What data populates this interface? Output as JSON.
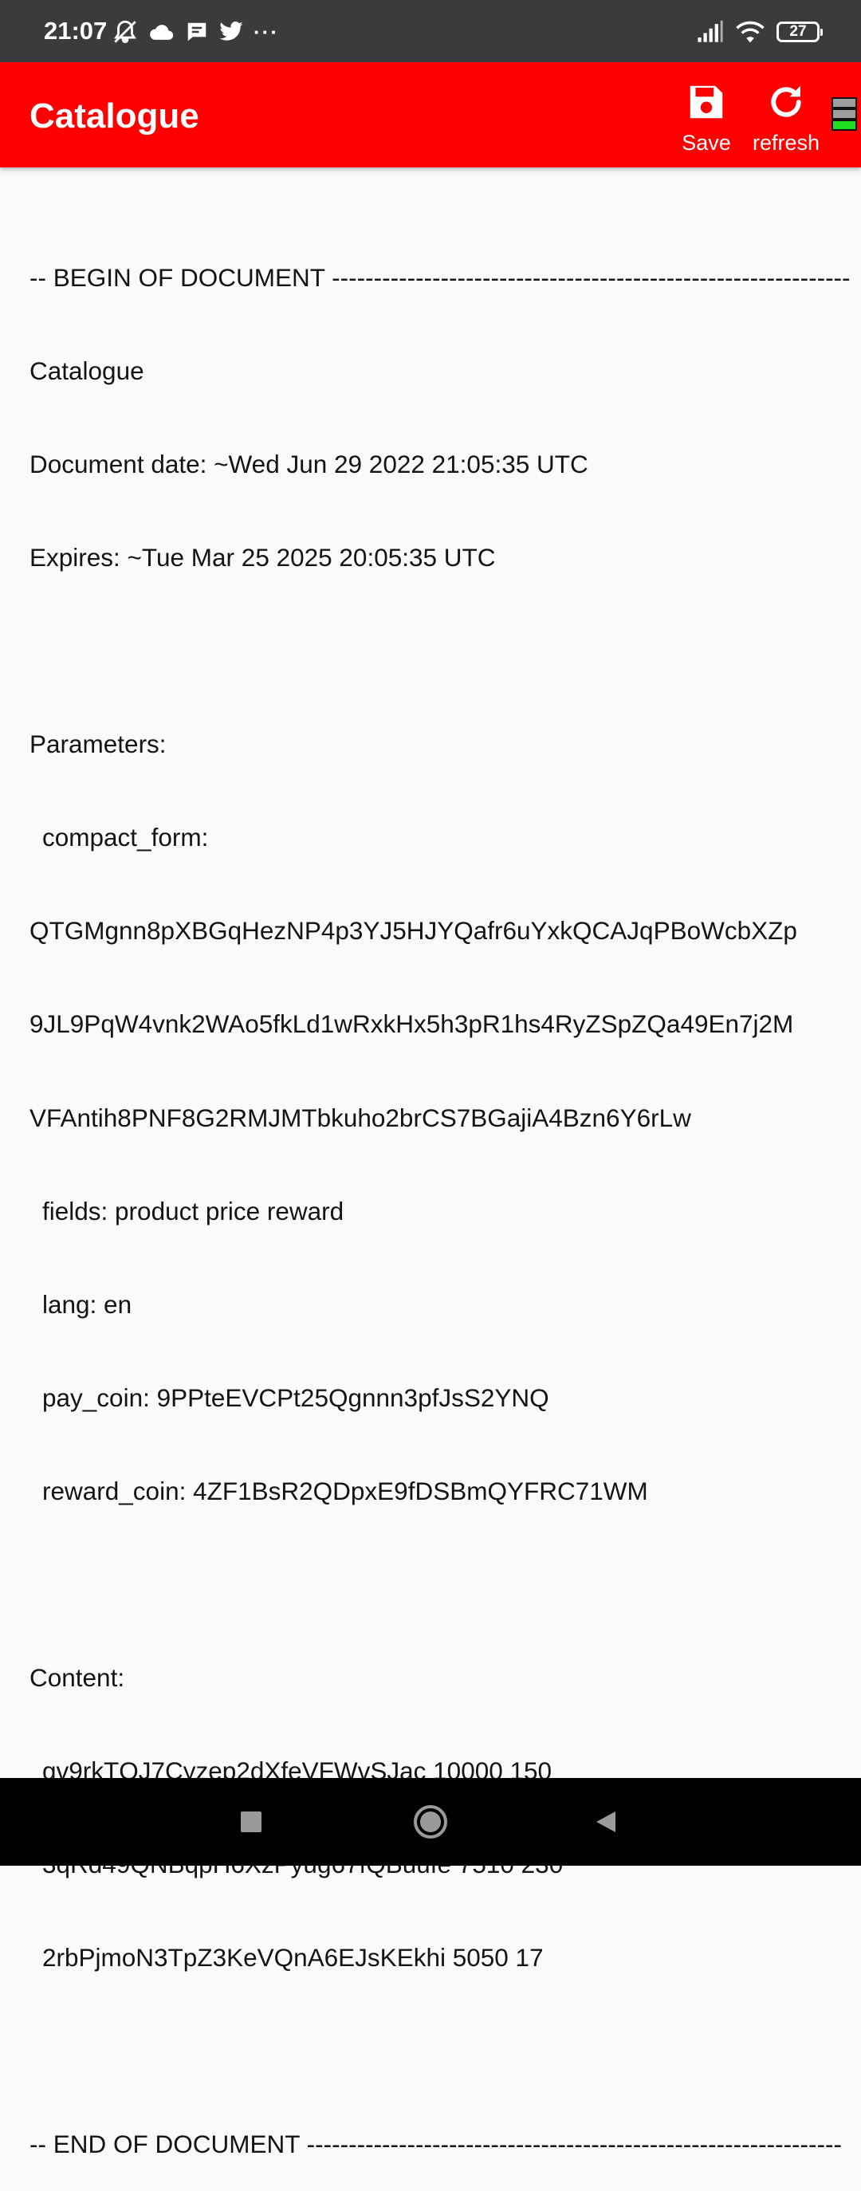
{
  "status_bar": {
    "time": "21:07",
    "left_icons": [
      "mute-icon",
      "cloud-icon",
      "message-icon",
      "twitter-icon",
      "more-dots-icon"
    ],
    "more_label": "···",
    "right_icons": [
      "signal-icon",
      "wifi-icon",
      "battery-icon"
    ],
    "battery_level": "27"
  },
  "app_bar": {
    "title": "Catalogue",
    "background": "#ff0000",
    "save_label": "Save",
    "refresh_label": "refresh",
    "indicator_colors": [
      "#9e9e9e",
      "#9e9e9e",
      "#22dd22"
    ]
  },
  "document": {
    "begin_line": "-- BEGIN OF DOCUMENT --------------------------------------------------------------",
    "name": "Catalogue",
    "date_line": "Document date: ~Wed Jun 29 2022 21:05:35 UTC",
    "expires_line": "Expires: ~Tue Mar 25 2025 20:05:35 UTC",
    "parameters_header": "Parameters:",
    "compact_form_label": "compact_form:",
    "compact_form_lines": [
      "QTGMgnn8pXBGqHezNP4p3YJ5HJYQafr6uYxkQCAJqPBoWcbXZp",
      "9JL9PqW4vnk2WAo5fkLd1wRxkHx5h3pR1hs4RyZSpZQa49En7j2M",
      "VFAntih8PNF8G2RMJMTbkuho2brCS7BGajiA4Bzn6Y6rLw"
    ],
    "fields_line": "fields: product price reward",
    "lang_line": "lang: en",
    "pay_coin_line": "pay_coin: 9PPteEVCPt25Qgnnn3pfJsS2YNQ",
    "reward_coin_line": "reward_coin: 4ZF1BsR2QDpxE9fDSBmQYFRC71WM",
    "content_header": "Content:",
    "content_lines": [
      "gv9rkTQJ7Cyzep2dXfeVFWvSJac 10000 150",
      "3qRd49QNBqpH6XzPyug67fQBuufe 7510 230",
      "2rbPjmoN3TpZ3KeVQnA6EJsKEkhi 5050 17"
    ],
    "end_line": "-- END OF DOCUMENT ----------------------------------------------------------------"
  },
  "nav_bar": {
    "buttons": [
      "recents-icon",
      "home-icon",
      "back-icon"
    ]
  }
}
